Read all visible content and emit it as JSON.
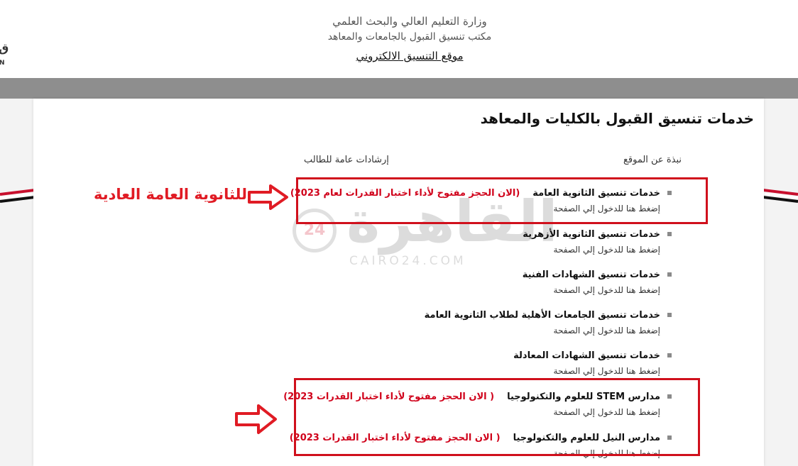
{
  "header": {
    "ministry": "وزارة التعليم العالي والبحث العلمي",
    "office": "مكتب تنسيق القبول بالجامعات والمعاهد",
    "site_link": "موقع التنسيق الالكتروني",
    "left_logo_glyph": "ق",
    "left_logo_text": "N"
  },
  "main": {
    "title": "خدمات تنسيق القبول بالكليات والمعاهد",
    "subnav": {
      "about": "نبذة عن الموقع",
      "guide": "إرشادات عامة للطالب"
    },
    "services": [
      {
        "title": "خدمات تنسيق الثانوية العامة",
        "note": "(الان الحجز مفتوح لأداء اختبار القدرات لعام 2023)",
        "sub": "إضغط هنا للدخول إلي الصفحة"
      },
      {
        "title": "خدمات تنسيق الثانوية الأزهرية",
        "note": "",
        "sub": "إضغط هنا للدخول إلي الصفحة"
      },
      {
        "title": "خدمات تنسيق الشهادات الفنية",
        "note": "",
        "sub": "إضغط هنا للدخول إلي الصفحة"
      },
      {
        "title": "خدمات تنسيق الجامعات الأهلية لطلاب الثانوية العامة",
        "note": "",
        "sub": "إضغط هنا للدخول إلي الصفحة"
      },
      {
        "title": "خدمات تنسيق الشهادات المعادلة",
        "note": "",
        "sub": "إضغط هنا للدخول إلي الصفحة"
      },
      {
        "title": "مدارس STEM للعلوم والتكنولوجيا",
        "note": "( الان الحجز مفتوح لأداء اختبار القدرات 2023)",
        "sub": "إضغط هنا للدخول إلي الصفحة"
      },
      {
        "title": "مدارس النيل للعلوم والتكنولوجيا",
        "note": "( الان الحجز مفتوح لأداء اختبار القدرات 2023)",
        "sub": "إضغط هنا للدخول إلي الصفحة"
      }
    ]
  },
  "annotation": {
    "callout": "للثانوية العامة العادية"
  },
  "watermark": {
    "badge": "24",
    "text": "القاهرة",
    "sub": "CAIRO24.COM"
  },
  "colors": {
    "accent_red": "#d0021b",
    "nav_gray": "#8e8e8e",
    "bullet_gray": "#8a8a8a"
  }
}
